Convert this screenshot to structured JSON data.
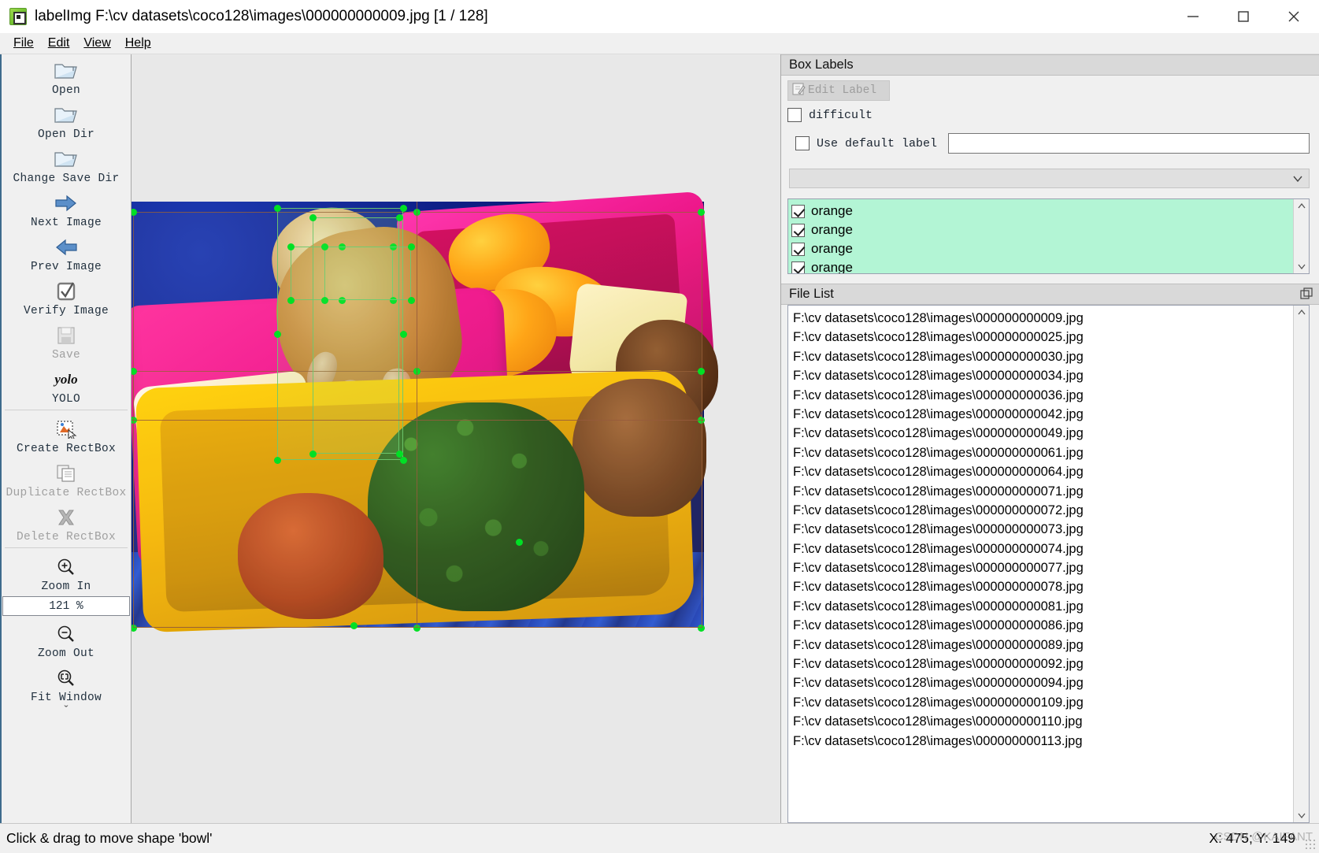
{
  "window": {
    "title": "labelImg F:\\cv datasets\\coco128\\images\\000000000009.jpg [1 / 128]",
    "app_icon": "labelimg-icon",
    "minimize": "─",
    "maximize": "□",
    "close": "✕"
  },
  "menubar": {
    "items": [
      {
        "label": "File"
      },
      {
        "label": "Edit"
      },
      {
        "label": "View"
      },
      {
        "label": "Help"
      }
    ]
  },
  "toolbar": {
    "items": [
      {
        "label": "Open",
        "icon": "open-folder-icon",
        "enabled": true
      },
      {
        "label": "Open Dir",
        "icon": "open-folder-icon",
        "enabled": true
      },
      {
        "label": "Change Save Dir",
        "icon": "open-folder-icon",
        "enabled": true
      },
      {
        "label": "Next Image",
        "icon": "arrow-right-icon",
        "enabled": true
      },
      {
        "label": "Prev Image",
        "icon": "arrow-left-icon",
        "enabled": true
      },
      {
        "label": "Verify Image",
        "icon": "checkbox-tick-icon",
        "enabled": true
      },
      {
        "label": "Save",
        "icon": "floppy-save-icon",
        "enabled": false
      },
      {
        "label": "YOLO",
        "icon": "yolo-text-icon",
        "enabled": true
      },
      {
        "label": "Create RectBox",
        "icon": "create-rectbox-icon",
        "enabled": true
      },
      {
        "label": "Duplicate RectBox",
        "icon": "duplicate-rectbox-icon",
        "enabled": false
      },
      {
        "label": "Delete RectBox",
        "icon": "delete-cross-icon",
        "enabled": false
      },
      {
        "label": "Zoom In",
        "icon": "magnifier-plus-icon",
        "enabled": true
      }
    ],
    "yolo_glyph": "yolo",
    "zoom_value": "121 %",
    "zoom_out": {
      "label": "Zoom Out",
      "icon": "magnifier-minus-icon"
    },
    "fit_window": {
      "label": "Fit Window",
      "icon": "magnifier-fit-icon"
    },
    "expander": "ˇ"
  },
  "box_labels": {
    "title": "Box Labels",
    "edit_label_button": "Edit Label",
    "edit_label_icon": "pencil-edit-icon",
    "difficult_checkbox": {
      "label": "difficult",
      "checked": false
    },
    "use_default_label": {
      "label": "Use default label",
      "checked": false
    },
    "default_label_value": "",
    "default_label_placeholder": "",
    "combo_value": "",
    "labels": [
      {
        "text": "orange",
        "checked": true
      },
      {
        "text": "orange",
        "checked": true
      },
      {
        "text": "orange",
        "checked": true
      },
      {
        "text": "orange",
        "checked": true
      }
    ],
    "list_background": "#b3f5d5"
  },
  "file_list": {
    "title": "File List",
    "float_icon": "undock-icon",
    "files": [
      "F:\\cv datasets\\coco128\\images\\000000000009.jpg",
      "F:\\cv datasets\\coco128\\images\\000000000025.jpg",
      "F:\\cv datasets\\coco128\\images\\000000000030.jpg",
      "F:\\cv datasets\\coco128\\images\\000000000034.jpg",
      "F:\\cv datasets\\coco128\\images\\000000000036.jpg",
      "F:\\cv datasets\\coco128\\images\\000000000042.jpg",
      "F:\\cv datasets\\coco128\\images\\000000000049.jpg",
      "F:\\cv datasets\\coco128\\images\\000000000061.jpg",
      "F:\\cv datasets\\coco128\\images\\000000000064.jpg",
      "F:\\cv datasets\\coco128\\images\\000000000071.jpg",
      "F:\\cv datasets\\coco128\\images\\000000000072.jpg",
      "F:\\cv datasets\\coco128\\images\\000000000073.jpg",
      "F:\\cv datasets\\coco128\\images\\000000000074.jpg",
      "F:\\cv datasets\\coco128\\images\\000000000077.jpg",
      "F:\\cv datasets\\coco128\\images\\000000000078.jpg",
      "F:\\cv datasets\\coco128\\images\\000000000081.jpg",
      "F:\\cv datasets\\coco128\\images\\000000000086.jpg",
      "F:\\cv datasets\\coco128\\images\\000000000089.jpg",
      "F:\\cv datasets\\coco128\\images\\000000000092.jpg",
      "F:\\cv datasets\\coco128\\images\\000000000094.jpg",
      "F:\\cv datasets\\coco128\\images\\000000000109.jpg",
      "F:\\cv datasets\\coco128\\images\\000000000110.jpg",
      "F:\\cv datasets\\coco128\\images\\000000000113.jpg"
    ]
  },
  "statusbar": {
    "message": "Click & drag to move shape 'bowl'",
    "coordinates": "X: 475; Y: 149",
    "watermark": "CSDN @KAIFANT"
  },
  "canvas": {
    "zoom_percent": "121 %",
    "selected_shape": "bowl",
    "vertex_color": "#00e025",
    "shape_color": "#6ec86e"
  }
}
